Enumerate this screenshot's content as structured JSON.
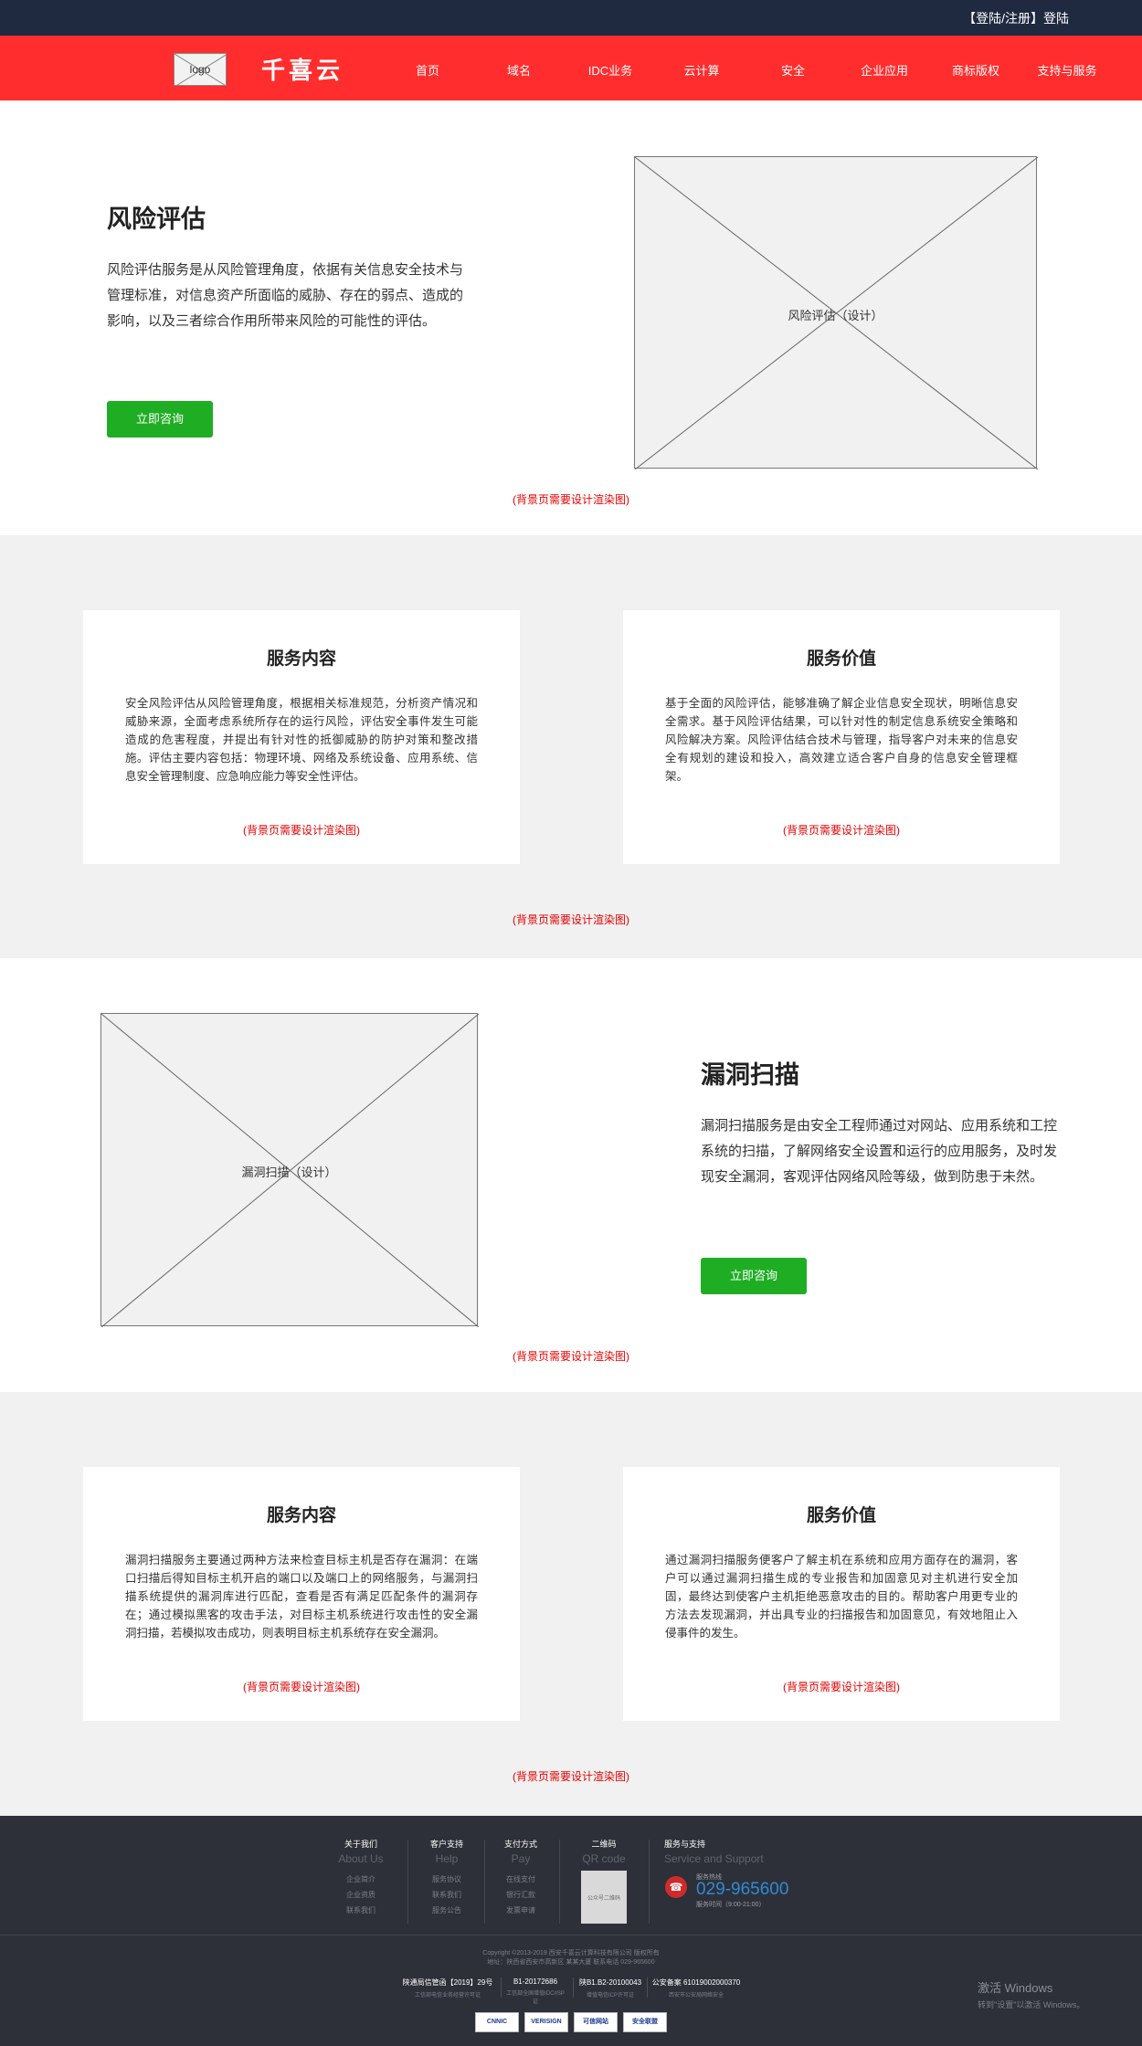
{
  "topbar": {
    "login_label": "【登陆/注册】登陆"
  },
  "nav": {
    "logo_text": "logo",
    "brand": "千喜云",
    "items": [
      "首页",
      "域名",
      "IDC业务",
      "云计算",
      "安全",
      "企业应用",
      "商标版权",
      "支持与服务"
    ]
  },
  "risk": {
    "title": "风险评估",
    "desc": "风险评估服务是从风险管理角度，依据有关信息安全技术与管理标准，对信息资产所面临的威胁、存在的弱点、造成的影响，以及三者综合作用所带来风险的可能性的评估。",
    "button": "立即咨询",
    "image_label": "风险评估（设计）",
    "note": "(背景页需要设计渲染图)"
  },
  "risk_cards": {
    "content": {
      "title": "服务内容",
      "text": "安全风险评估从风险管理角度，根据相关标准规范，分析资产情况和威胁来源，全面考虑系统所存在的运行风险，评估安全事件发生可能造成的危害程度，并提出有针对性的抵御威胁的防护对策和整改措施。评估主要内容包括：物理环境、网络及系统设备、应用系统、信息安全管理制度、应急响应能力等安全性评估。",
      "note": "(背景页需要设计渲染图)"
    },
    "value": {
      "title": "服务价值",
      "text": "基于全面的风险评估，能够准确了解企业信息安全现状，明晰信息安全需求。基于风险评估结果，可以针对性的制定信息系统安全策略和风险解决方案。风险评估结合技术与管理，指导客户对未来的信息安全有规划的建设和投入，高效建立适合客户自身的信息安全管理框架。",
      "note": "(背景页需要设计渲染图)"
    },
    "section_note": "(背景页需要设计渲染图)"
  },
  "vuln": {
    "title": "漏洞扫描",
    "desc": "漏洞扫描服务是由安全工程师通过对网站、应用系统和工控系统的扫描，了解网络安全设置和运行的应用服务，及时发现安全漏洞，客观评估网络风险等级，做到防患于未然。",
    "button": "立即咨询",
    "image_label": "漏洞扫描（设计）",
    "note": "(背景页需要设计渲染图)"
  },
  "vuln_cards": {
    "content": {
      "title": "服务内容",
      "text": "漏洞扫描服务主要通过两种方法来检查目标主机是否存在漏洞：在端口扫描后得知目标主机开启的端口以及端口上的网络服务，与漏洞扫描系统提供的漏洞库进行匹配，查看是否有满足匹配条件的漏洞存在；通过模拟黑客的攻击手法，对目标主机系统进行攻击性的安全漏洞扫描，若模拟攻击成功，则表明目标主机系统存在安全漏洞。",
      "note": "(背景页需要设计渲染图)"
    },
    "value": {
      "title": "服务价值",
      "text": "通过漏洞扫描服务便客户了解主机在系统和应用方面存在的漏洞，客户可以通过漏洞扫描生成的专业报告和加固意见对主机进行安全加固，最终达到使客户主机拒绝恶意攻击的目的。帮助客户用更专业的方法去发现漏洞，并出具专业的扫描报告和加固意见，有效地阻止入侵事件的发生。",
      "note": "(背景页需要设计渲染图)"
    },
    "section_note": "(背景页需要设计渲染图)"
  },
  "footer": {
    "columns": [
      {
        "title": "关于我们",
        "sub": "About Us",
        "links": [
          "企业简介",
          "企业资质",
          "联系我们"
        ]
      },
      {
        "title": "客户支持",
        "sub": "Help",
        "links": [
          "服务协议",
          "联系我们",
          "服务公告"
        ]
      },
      {
        "title": "支付方式",
        "sub": "Pay",
        "links": [
          "在线支付",
          "银行汇款",
          "发票申请"
        ]
      },
      {
        "title": "二维码",
        "sub": "QR code",
        "links": []
      },
      {
        "title": "服务与支持",
        "sub": "Service and Support",
        "links": []
      }
    ],
    "qr_text": "公众号二维码",
    "phone_label": "服务热线",
    "phone": "029-965600",
    "phone_time": "服务时间（9:00-21:00）",
    "copyright": "Copyright ©2013-2019 西安千喜云计算科技有限公司 版权所有",
    "address": "地址：陕西省西安市高新区 某某大厦 联系电话 029-965600",
    "licenses": [
      {
        "main": "陕通局信管函【2019】29号",
        "sub": "工信部电信业务经营许可证"
      },
      {
        "main": "B1-20172686",
        "sub": "工信部全国增值IDC/ISP证"
      },
      {
        "main": "陕B1.B2-20100043",
        "sub": "增值电信ICP许可证"
      },
      {
        "main": "公安备案 61019002000370",
        "sub": "西安市公安局网络安全"
      }
    ],
    "badges": [
      "CNNIC",
      "VERISIGN",
      "可信网站",
      "安全联盟"
    ]
  },
  "watermark": {
    "line1": "激活 Windows",
    "line2": "转到\"设置\"以激活 Windows。"
  }
}
